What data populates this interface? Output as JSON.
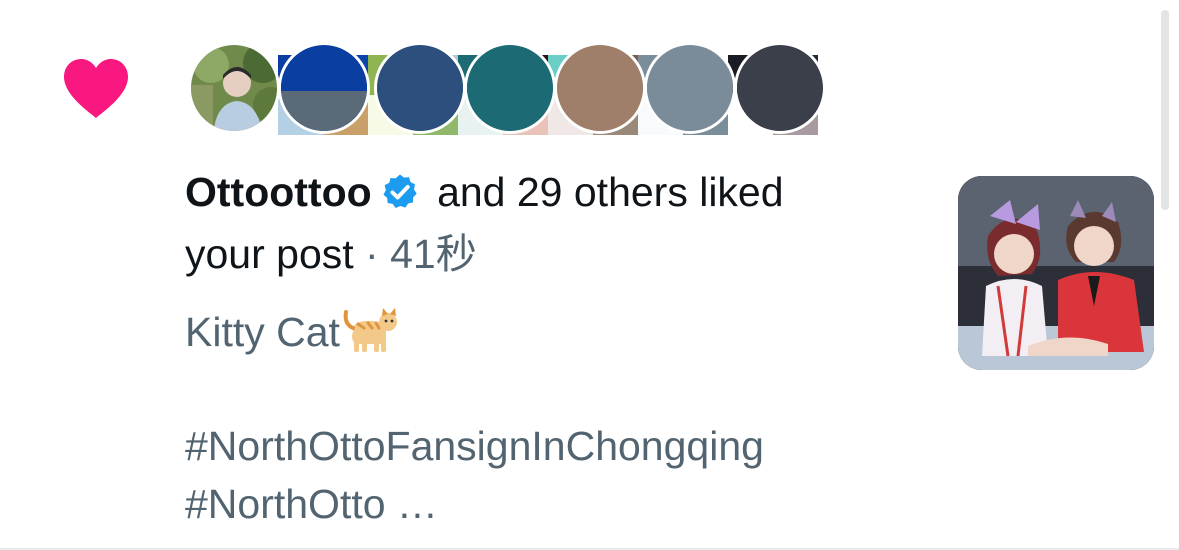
{
  "notification": {
    "type_icon": "heart-icon",
    "heart_color": "#f91880",
    "user_name": "Ottoottoo",
    "verified_icon": "verified-badge-icon",
    "verified_color": "#1d9bf0",
    "action_text": " and 29 others liked",
    "action_text_2": "your post",
    "separator": " · ",
    "time": "41秒"
  },
  "post": {
    "text": "Kitty Cat",
    "emoji": "cat-emoji-icon",
    "hashtag_1": "#NorthOttoFansignInChongqing",
    "hashtag_2": "#NorthOtto …"
  },
  "avatars": [
    {
      "name": "avatar-ottoottoo"
    },
    {
      "name": "avatar-2"
    },
    {
      "name": "avatar-3"
    },
    {
      "name": "avatar-4"
    },
    {
      "name": "avatar-5"
    },
    {
      "name": "avatar-6"
    },
    {
      "name": "avatar-7"
    }
  ],
  "thumbnail": {
    "name": "post-thumbnail"
  }
}
